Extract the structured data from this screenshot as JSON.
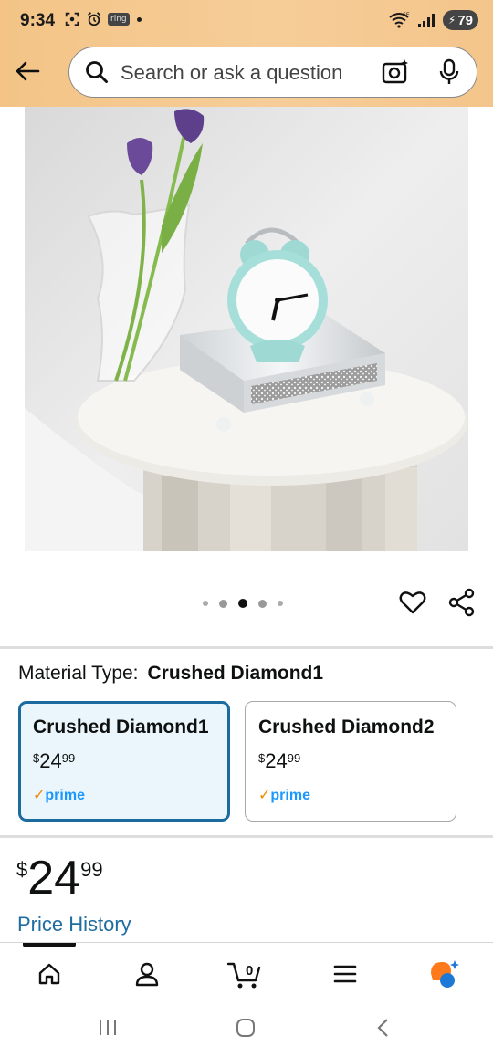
{
  "status_bar": {
    "time": "9:34",
    "ring_badge": "ring",
    "network": "6E",
    "battery": "79"
  },
  "header": {
    "search_placeholder": "Search or ask a question"
  },
  "product": {
    "image_icon": "product-photo-alarm-clock-on-mirrored-tray",
    "carousel": {
      "count": 5,
      "active_index": 2
    }
  },
  "options": {
    "material_label": "Material Type:",
    "material_selected": "Crushed Diamond1",
    "variants": [
      {
        "name": "Crushed Diamond1",
        "currency": "$",
        "whole": "24",
        "fraction": "99",
        "prime": "prime",
        "selected": true
      },
      {
        "name": "Crushed Diamond2",
        "currency": "$",
        "whole": "24",
        "fraction": "99",
        "prime": "prime",
        "selected": false
      }
    ]
  },
  "price": {
    "currency": "$",
    "whole": "24",
    "fraction": "99",
    "history_link": "Price History"
  },
  "bottom_nav": {
    "cart_count": "0",
    "items": [
      "home-icon",
      "account-icon",
      "cart-icon",
      "menu-icon",
      "rufus-icon"
    ]
  },
  "colors": {
    "header_gradient": "#f6cd98",
    "selected_border": "#1c6b9e",
    "selected_bg": "#eaf6fb",
    "link": "#1f6ca0",
    "prime": "#1a98ff",
    "prime_check": "#f08a00"
  }
}
